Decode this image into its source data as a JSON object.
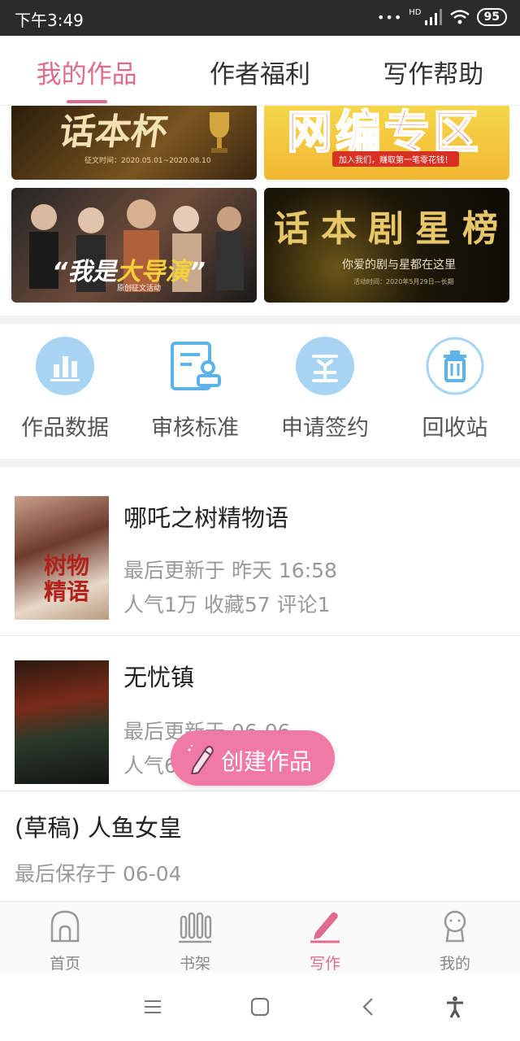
{
  "status_bar": {
    "time": "下午3:49",
    "battery": "95",
    "network": "HD"
  },
  "tabs": [
    {
      "label": "我的作品",
      "active": true
    },
    {
      "label": "作者福利",
      "active": false
    },
    {
      "label": "写作帮助",
      "active": false
    }
  ],
  "banners": {
    "b1": {
      "title": "话本杯",
      "caption": "征文时间：2020.05.01~2020.08.10"
    },
    "b2": {
      "title": "网编专区",
      "caption": "加入我们，赚取第一笔零花钱！"
    },
    "b3": {
      "title_prefix": "“我是",
      "title_highlight": "大导演",
      "title_suffix": "”",
      "caption": "原创征文活动"
    },
    "b4": {
      "title": "话本剧星榜",
      "subtitle": "你爱的剧与星都在这里",
      "caption": "活动时间：2020年5月29日—长期"
    }
  },
  "actions": [
    {
      "label": "作品数据",
      "icon": "bar-chart-icon"
    },
    {
      "label": "审核标准",
      "icon": "review-document-icon"
    },
    {
      "label": "申请签约",
      "icon": "sign-icon"
    },
    {
      "label": "回收站",
      "icon": "trash-icon"
    }
  ],
  "works": [
    {
      "title": "哪吒之树精物语",
      "updated": "最后更新于 昨天 16:58",
      "stats": "人气1万 收藏57 评论1",
      "cover_text": "树物精语"
    },
    {
      "title": "无忧镇",
      "updated": "最后更新于 06-06",
      "stats": "人气6"
    },
    {
      "title": "(草稿) 人鱼女皇",
      "updated": "最后保存于 06-04"
    }
  ],
  "fab": {
    "label": "创建作品"
  },
  "bottom_nav": [
    {
      "label": "首页",
      "icon": "home-icon",
      "active": false
    },
    {
      "label": "书架",
      "icon": "bookshelf-icon",
      "active": false
    },
    {
      "label": "写作",
      "icon": "pen-icon",
      "active": true
    },
    {
      "label": "我的",
      "icon": "profile-icon",
      "active": false
    }
  ],
  "colors": {
    "accent": "#e06b8c",
    "fab": "#f079a6",
    "icon_blue": "#5bb3e8"
  }
}
